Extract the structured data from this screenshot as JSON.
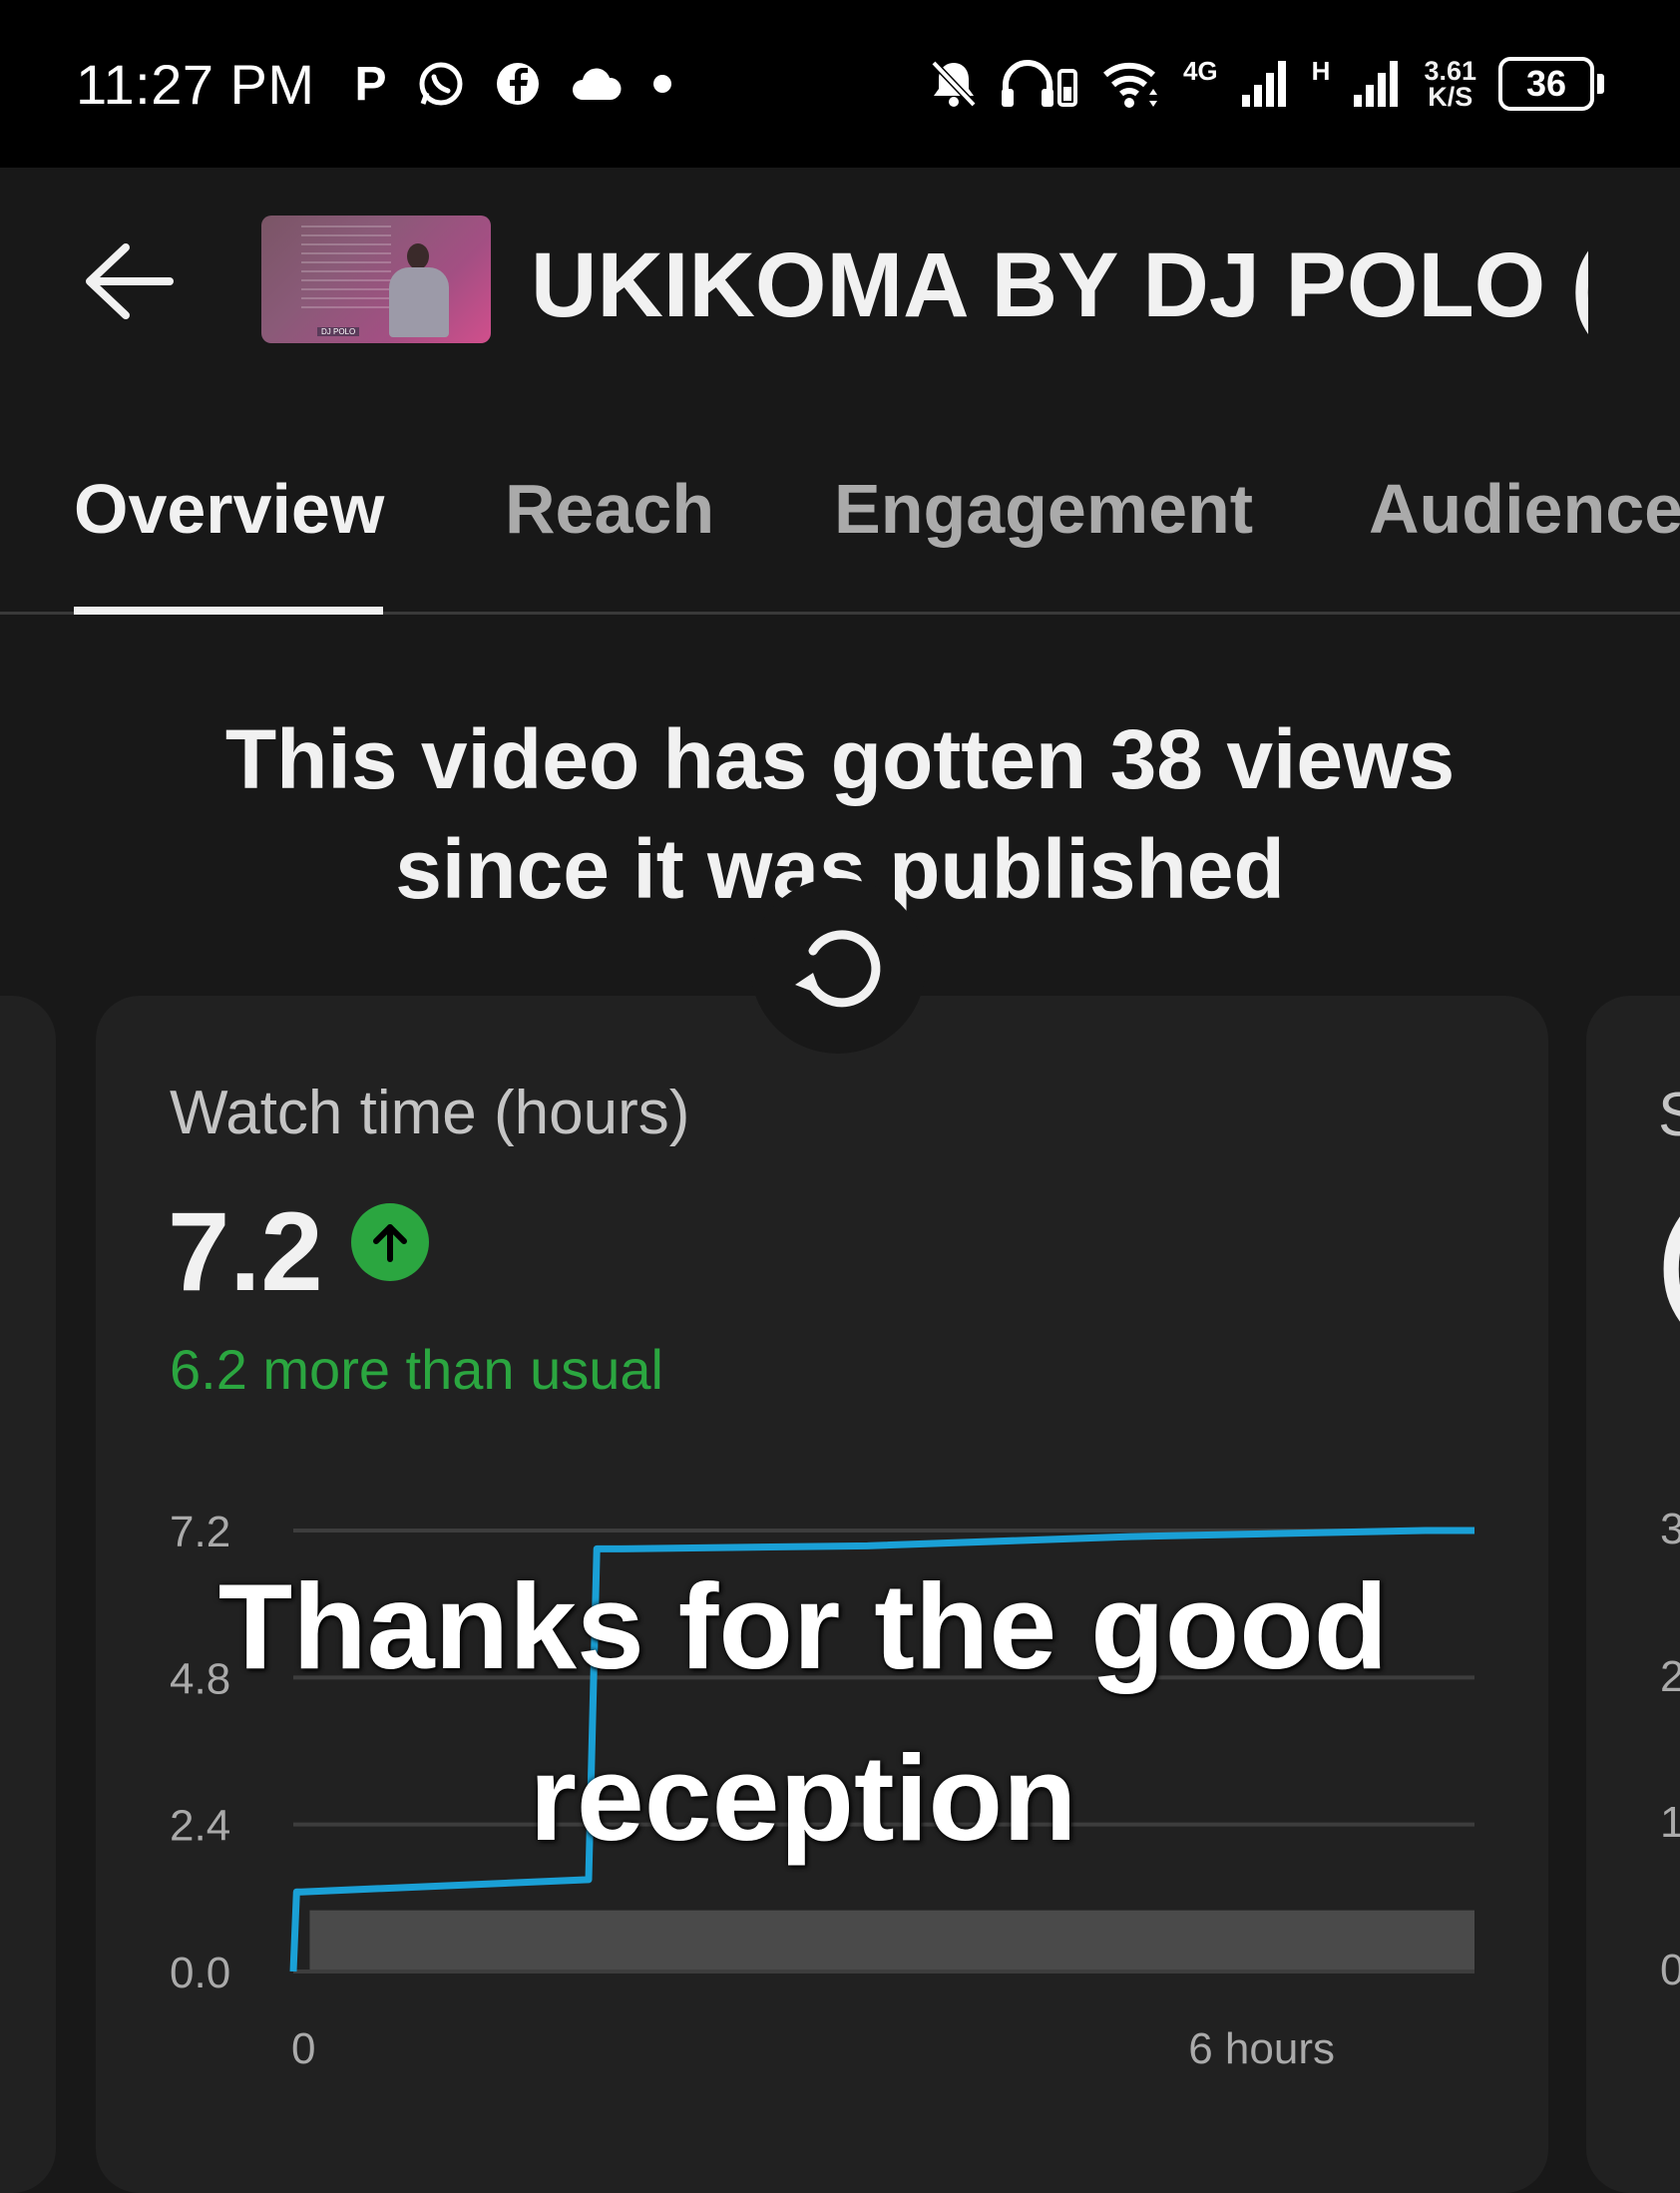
{
  "status_bar": {
    "time": "11:27 PM",
    "left_icons": [
      "p-icon",
      "whatsapp-icon",
      "facebook-icon",
      "cloud-icon",
      "dot-icon"
    ],
    "network_label_1": "4G",
    "network_label_2": "H",
    "speed_value": "3.61",
    "speed_unit": "K/S",
    "battery": "36"
  },
  "header": {
    "title": "UKIKOMA BY DJ POLO (...",
    "thumbnail_tag": "DJ POLO"
  },
  "tabs": [
    {
      "label": "Overview",
      "active": true
    },
    {
      "label": "Reach",
      "active": false
    },
    {
      "label": "Engagement",
      "active": false
    },
    {
      "label": "Audience",
      "active": false
    }
  ],
  "headline": {
    "line1": "This video has gotten 38 views",
    "line2": "since it was published"
  },
  "metric_card": {
    "label": "Watch time (hours)",
    "value": "7.2",
    "trend": "up",
    "delta_text": "6.2 more than usual",
    "accent_color": "#2ba640",
    "line_color": "#1aa0d6"
  },
  "right_peek": {
    "label_fragment": "S",
    "value_fragment": "(",
    "ticks": [
      "3",
      "2",
      "1",
      "0"
    ]
  },
  "caption_overlay": {
    "line1": "Thanks for the good",
    "line2": "reception"
  },
  "chart_data": {
    "type": "line",
    "title": "",
    "xlabel": "",
    "ylabel": "",
    "x_ticks": [
      "0",
      "6 hours"
    ],
    "y_ticks": [
      "7.2",
      "4.8",
      "2.4",
      "0.0"
    ],
    "ylim": [
      0,
      7.2
    ],
    "xlim": [
      0,
      7.2
    ],
    "grid": true,
    "series": [
      {
        "x": [
          0,
          0.02,
          0.05,
          1.8,
          1.85,
          2.0,
          3.5,
          5.1,
          6.9,
          7.2
        ],
        "values": [
          0,
          1.3,
          1.3,
          1.5,
          6.9,
          6.9,
          6.95,
          7.1,
          7.2,
          7.2
        ]
      }
    ],
    "typical_range": {
      "x": [
        0.1,
        7.2
      ],
      "low": 0,
      "high": 1.0
    }
  }
}
